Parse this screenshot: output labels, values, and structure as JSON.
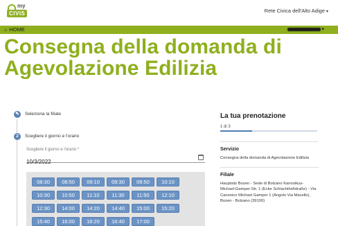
{
  "header": {
    "logo_my": "my",
    "logo_civis": "CIVIS",
    "portal_link": "Rete Civica dell'Alto Adige"
  },
  "navbar": {
    "home_label": "HOME"
  },
  "page": {
    "title": "Consegna della domanda di Agevolazione Edilizia"
  },
  "steps": [
    {
      "number": "",
      "label": "Seleziona la filiale"
    },
    {
      "number": "2",
      "label": "Scegliere il giorno e l'orario"
    }
  ],
  "date_field": {
    "label": "Scegliere il giorno e l'orario *",
    "value": "10/3/2022"
  },
  "time_slots": [
    "08:30",
    "08:50",
    "09:10",
    "09:30",
    "09:50",
    "10:10",
    "10:30",
    "10:50",
    "11:10",
    "11:30",
    "11:50",
    "12:10",
    "12:30",
    "14:00",
    "14:20",
    "14:40",
    "15:00",
    "15:20",
    "15:40",
    "16:00",
    "16:20",
    "16:40",
    "17:00"
  ],
  "booking": {
    "title": "La tua prenotazione",
    "progress_text": "1 di 3",
    "progress_value": 0.33,
    "service_heading": "Servizio",
    "service_value": "Consegna della domanda di Agevolazione Edilizia",
    "branch_heading": "Filiale",
    "branch_value": "Hauptsitz Bozen - Sede di Bolzano Kanonikus-Michael-Gamper-Str. 1 (Ecke Schlachthofstraße) - Via Canonico Michael Gamper 1 (Angolo Via Macello), Bozen - Bolzano (39100)"
  },
  "colors": {
    "brand_green": "#8faf1e",
    "slot_blue": "#6b93c5",
    "step_blue": "#5b82b4"
  }
}
